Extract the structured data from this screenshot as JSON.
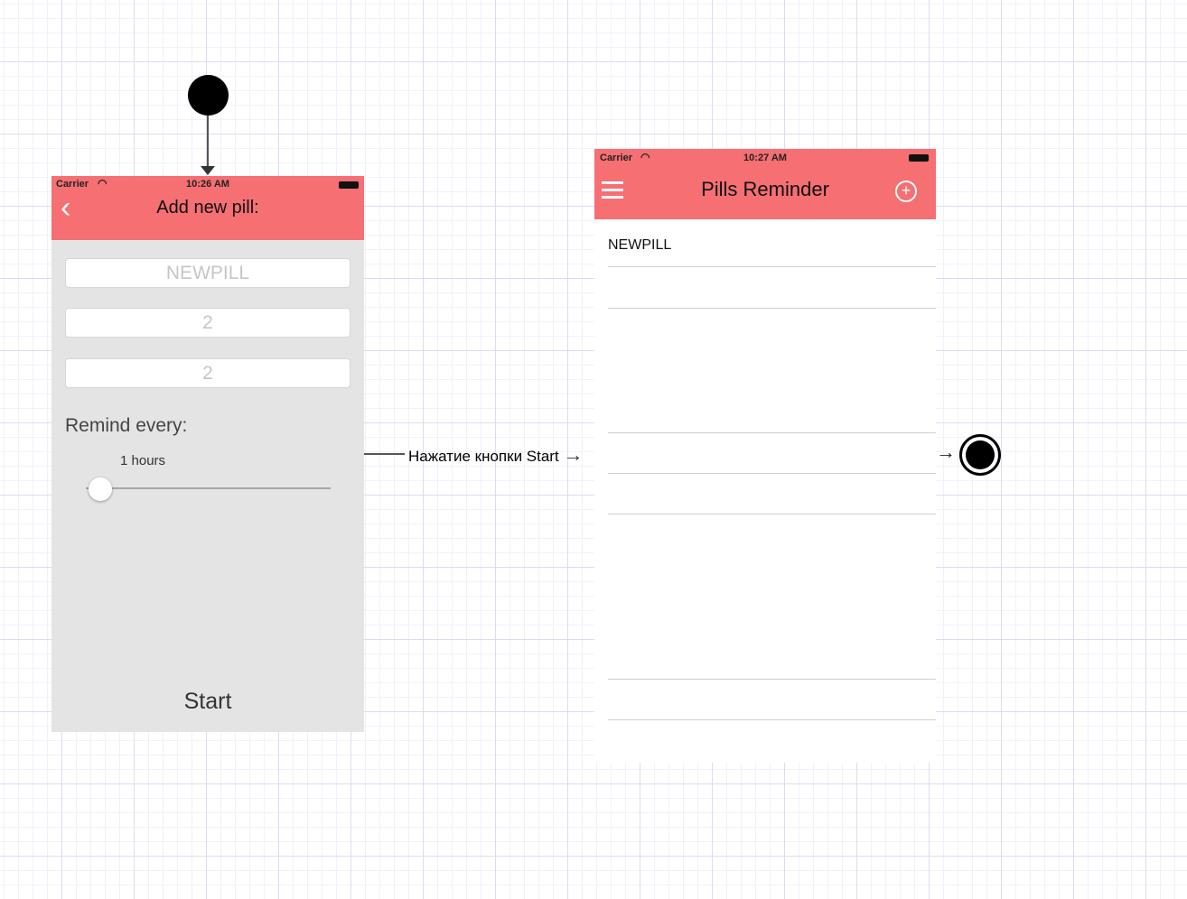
{
  "diagram": {
    "edge_label": "Нажатие кнопки Start"
  },
  "add_screen": {
    "status": {
      "carrier": "Carrier",
      "time": "10:26 AM"
    },
    "title": "Add new pill:",
    "fields": [
      "NEWPILL",
      "2",
      "2"
    ],
    "remind_label": "Remind every:",
    "slider_value_text": "1 hours",
    "slider_fraction": 0.05,
    "start_label": "Start",
    "accent_color": "#f56f73"
  },
  "list_screen": {
    "status": {
      "carrier": "Carrier",
      "time": "10:27 AM"
    },
    "title": "Pills Reminder",
    "items": [
      "NEWPILL"
    ],
    "accent_color": "#f56f73"
  },
  "icons": [
    "back-chevron-icon",
    "wifi-icon",
    "battery-icon",
    "menu-icon",
    "add-circle-icon"
  ]
}
